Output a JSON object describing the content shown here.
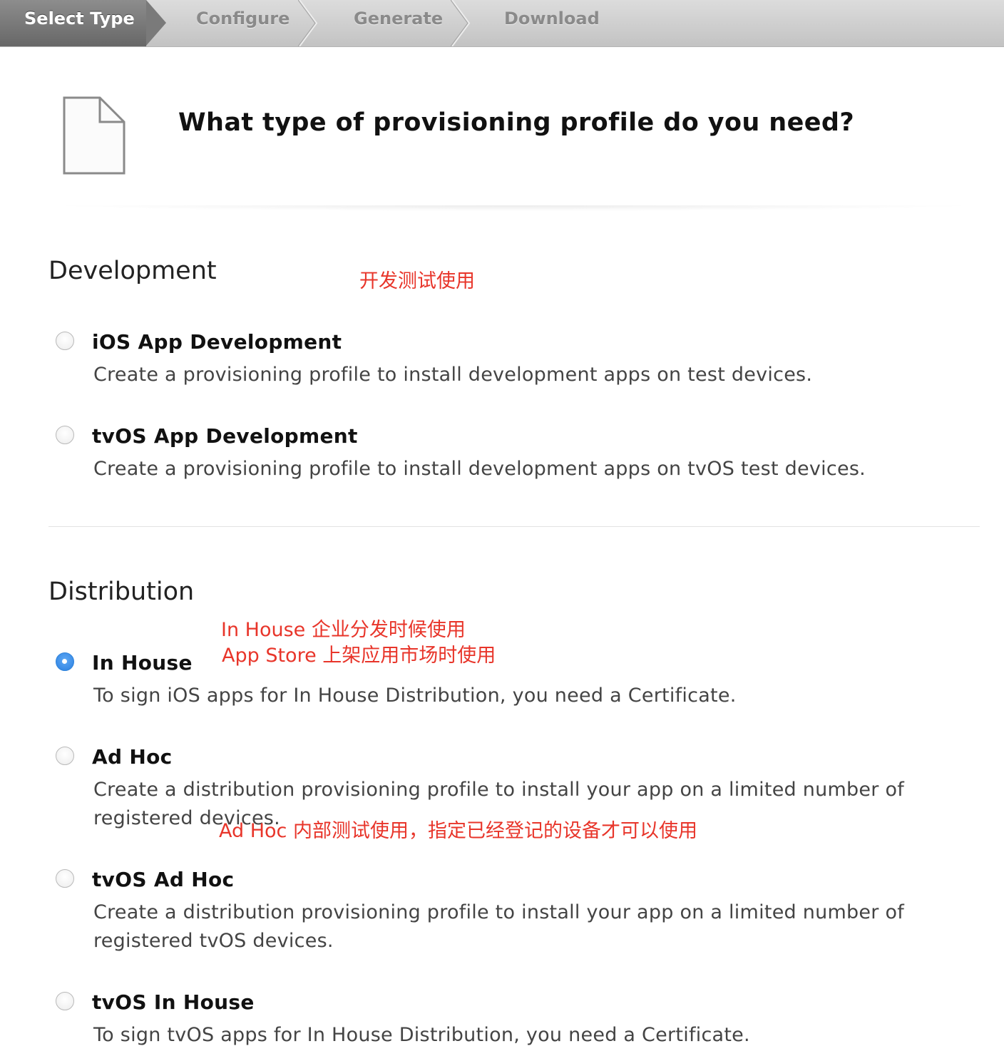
{
  "steps": [
    "Select Type",
    "Configure",
    "Generate",
    "Download"
  ],
  "title": "What type of provisioning profile do you need?",
  "development": {
    "heading": "Development",
    "note": "开发测试使用",
    "options": [
      {
        "label": "iOS App Development",
        "desc": "Create a provisioning profile to install development apps on test devices.",
        "selected": false
      },
      {
        "label": "tvOS App Development",
        "desc": "Create a provisioning profile to install development apps on tvOS test devices.",
        "selected": false
      }
    ]
  },
  "distribution": {
    "heading": "Distribution",
    "note_line1": "In House  企业分发时候使用",
    "note_line2": "App Store 上架应用市场时使用",
    "adhoc_note": "Ad Hoc 内部测试使用，指定已经登记的设备才可以使用",
    "options": [
      {
        "label": "In House",
        "desc": "To sign iOS apps for In House Distribution, you need a Certificate.",
        "selected": true
      },
      {
        "label": "Ad Hoc",
        "desc": "Create a distribution provisioning profile to install your app on a limited number of registered devices.",
        "selected": false
      },
      {
        "label": "tvOS Ad Hoc",
        "desc": "Create a distribution provisioning profile to install your app on a limited number of registered tvOS devices.",
        "selected": false
      },
      {
        "label": "tvOS In House",
        "desc": "To sign tvOS apps for In House Distribution, you need a Certificate.",
        "selected": false
      }
    ]
  },
  "colors": {
    "accent_blue": "#2f83db",
    "annotation_red": "#e8352a"
  }
}
